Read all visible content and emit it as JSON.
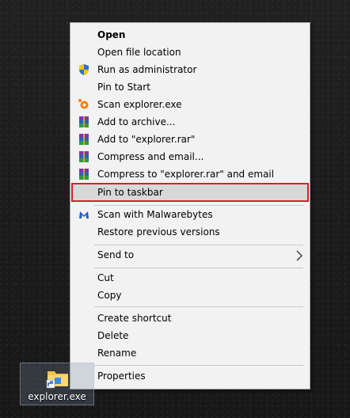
{
  "context_menu": {
    "items": {
      "open": "Open",
      "open_file_location": "Open file location",
      "run_as_admin": "Run as administrator",
      "pin_to_start": "Pin to Start",
      "scan_avast": "Scan explorer.exe",
      "add_to_archive": "Add to archive...",
      "add_to_rar": "Add to \"explorer.rar\"",
      "compress_email": "Compress and email...",
      "compress_rar_email": "Compress to \"explorer.rar\" and email",
      "pin_to_taskbar": "Pin to taskbar",
      "scan_malwarebytes": "Scan with Malwarebytes",
      "restore_versions": "Restore previous versions",
      "send_to": "Send to",
      "cut": "Cut",
      "copy": "Copy",
      "create_shortcut": "Create shortcut",
      "delete": "Delete",
      "rename": "Rename",
      "properties": "Properties"
    },
    "highlighted_item": "pin_to_taskbar",
    "highlight_color": "#d81f26",
    "icons": {
      "run_as_admin": "uac-shield-icon",
      "scan_avast": "avast-icon",
      "archive": "winrar-icon",
      "scan_malwarebytes": "malwarebytes-icon",
      "send_to": "chevron-right-icon"
    }
  },
  "desktop": {
    "shortcut_label": "explorer.exe",
    "shortcut_icon": "file-explorer-shortcut-icon"
  }
}
